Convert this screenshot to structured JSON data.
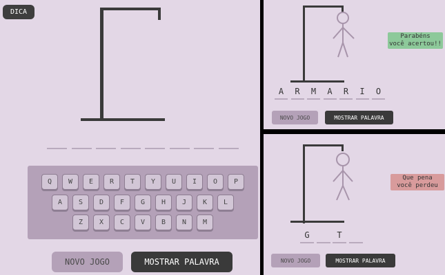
{
  "main": {
    "hint_label": "DICA",
    "slots_count": 8,
    "keyboard": {
      "rows": [
        [
          "Q",
          "W",
          "E",
          "R",
          "T",
          "Y",
          "U",
          "I",
          "O",
          "P"
        ],
        [
          "A",
          "S",
          "D",
          "F",
          "G",
          "H",
          "J",
          "K",
          "L"
        ],
        [
          "Z",
          "X",
          "C",
          "V",
          "B",
          "N",
          "M"
        ]
      ]
    },
    "new_game_label": "NOVO JOGO",
    "show_word_label": "MOSTRAR PALAVRA"
  },
  "win": {
    "letters": [
      "A",
      "R",
      "M",
      "A",
      "R",
      "I",
      "O"
    ],
    "toast_line1": "Parabéns",
    "toast_line2": "você acertou!!",
    "new_game_label": "NOVO JOGO",
    "show_word_label": "MOSTRAR PALAVRA"
  },
  "lose": {
    "letters": [
      "G",
      "",
      "T",
      ""
    ],
    "toast_line1": "Que pena",
    "toast_line2": "você perdeu",
    "new_game_label": "NOVO JOGO",
    "show_word_label": "MOSTRAR PALAVRA"
  },
  "colors": {
    "background": "#e3d7e6",
    "gallows": "#3a3a3a",
    "keyboard_bg": "#b4a1b8",
    "win_toast": "#8dc99a",
    "lose_toast": "#d89b9c"
  }
}
